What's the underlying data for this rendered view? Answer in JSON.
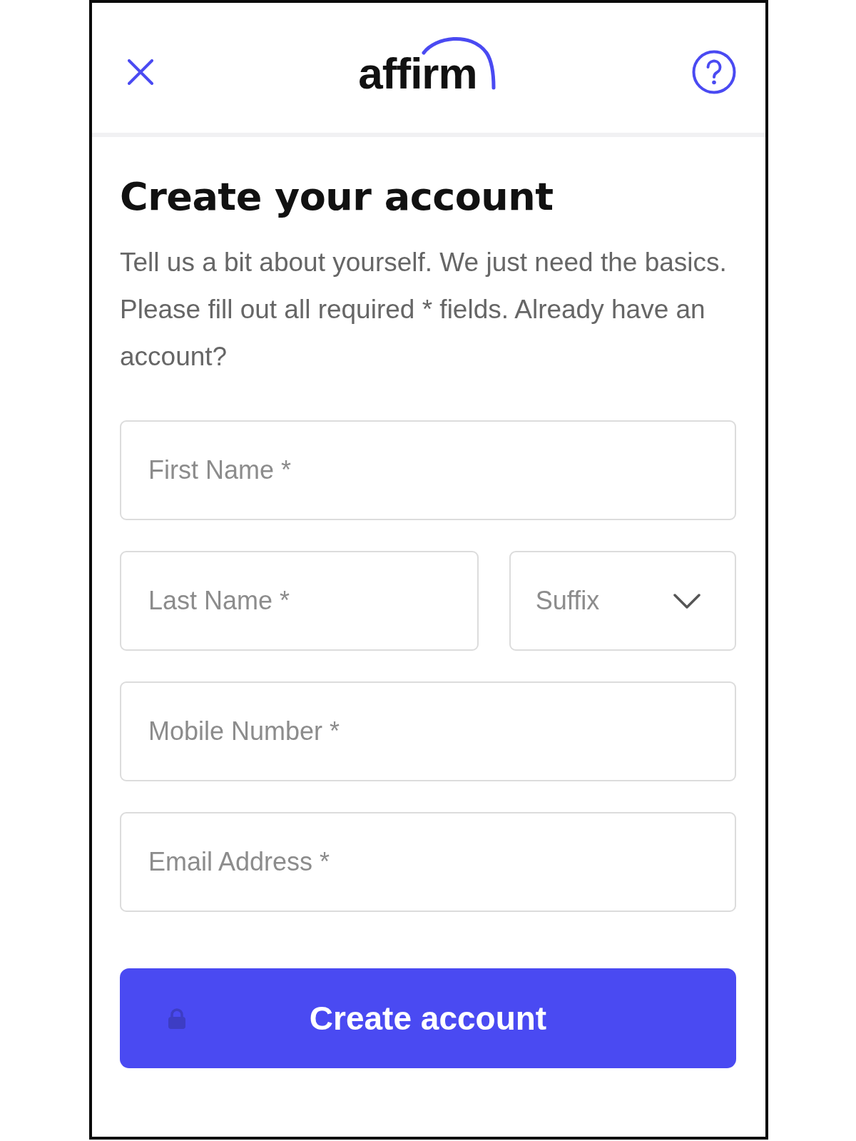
{
  "header": {
    "logo": "affirm"
  },
  "heading": "Create your account",
  "intro": "Tell us a bit about yourself. We just need the basics. Please fill out all required * fields. Already have an account?",
  "form_rows": [
    {
      "fields": [
        {
          "kind": "input",
          "placeholder": "First Name *"
        }
      ]
    },
    {
      "fields": [
        {
          "kind": "input",
          "placeholder": "Last Name *"
        },
        {
          "kind": "select",
          "placeholder": "Suffix"
        }
      ]
    },
    {
      "fields": [
        {
          "kind": "input",
          "placeholder": "Mobile Number *"
        }
      ]
    },
    {
      "fields": [
        {
          "kind": "input",
          "placeholder": "Email Address *"
        }
      ]
    }
  ],
  "submit_button": {
    "label": "Create account"
  }
}
